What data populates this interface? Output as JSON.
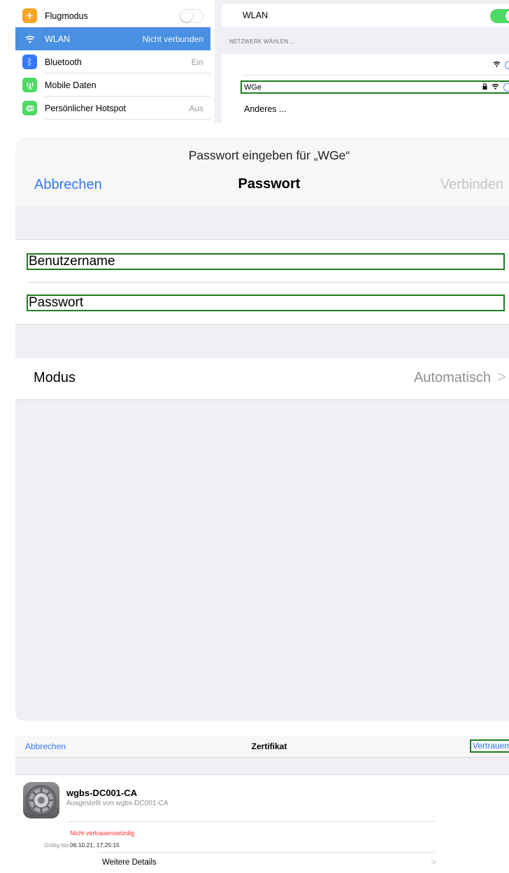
{
  "settings": {
    "sidebar": [
      {
        "label": "Flugmodus",
        "value": "",
        "icon": "airplane-icon",
        "color": "#f5a623",
        "glyph": "✈"
      },
      {
        "label": "WLAN",
        "value": "Nicht verbunden",
        "icon": "wifi-icon",
        "color": "#4a90e2",
        "glyph": "≋"
      },
      {
        "label": "Bluetooth",
        "value": "Ein",
        "icon": "bluetooth-icon",
        "color": "#3478f6",
        "glyph": "ᛒ"
      },
      {
        "label": "Mobile Daten",
        "value": "",
        "icon": "antenna-icon",
        "color": "#4cd964",
        "glyph": "◉"
      },
      {
        "label": "Persönlicher Hotspot",
        "value": "Aus",
        "icon": "hotspot-icon",
        "color": "#4cd964",
        "glyph": "⊚"
      }
    ],
    "wlan_label": "WLAN",
    "section_header": "NETZWERK WÄHLEN ...",
    "networks": [
      {
        "name": ""
      },
      {
        "name": "WGe"
      },
      {
        "name": "Anderes ..."
      }
    ]
  },
  "password_sheet": {
    "prompt": "Passwort eingeben für „WGe“",
    "cancel": "Abbrechen",
    "title": "Passwort",
    "connect": "Verbinden",
    "username_placeholder": "Benutzername",
    "password_placeholder": "Passwort",
    "mode_label": "Modus",
    "mode_value": "Automatisch",
    "chevron": ">"
  },
  "certificate": {
    "cancel": "Abbrechen",
    "title": "Zertifikat",
    "trust": "Vertrauen",
    "name": "wgbs-DC001-CA",
    "issuer": "Ausgestellt von wgbs-DC001-CA",
    "status": "Nicht vertrauenswürdig",
    "valid_label": "Gültig bis",
    "valid_value": "06.10.21, 17:25:15",
    "details": "Weitere Details",
    "chevron": ">"
  }
}
